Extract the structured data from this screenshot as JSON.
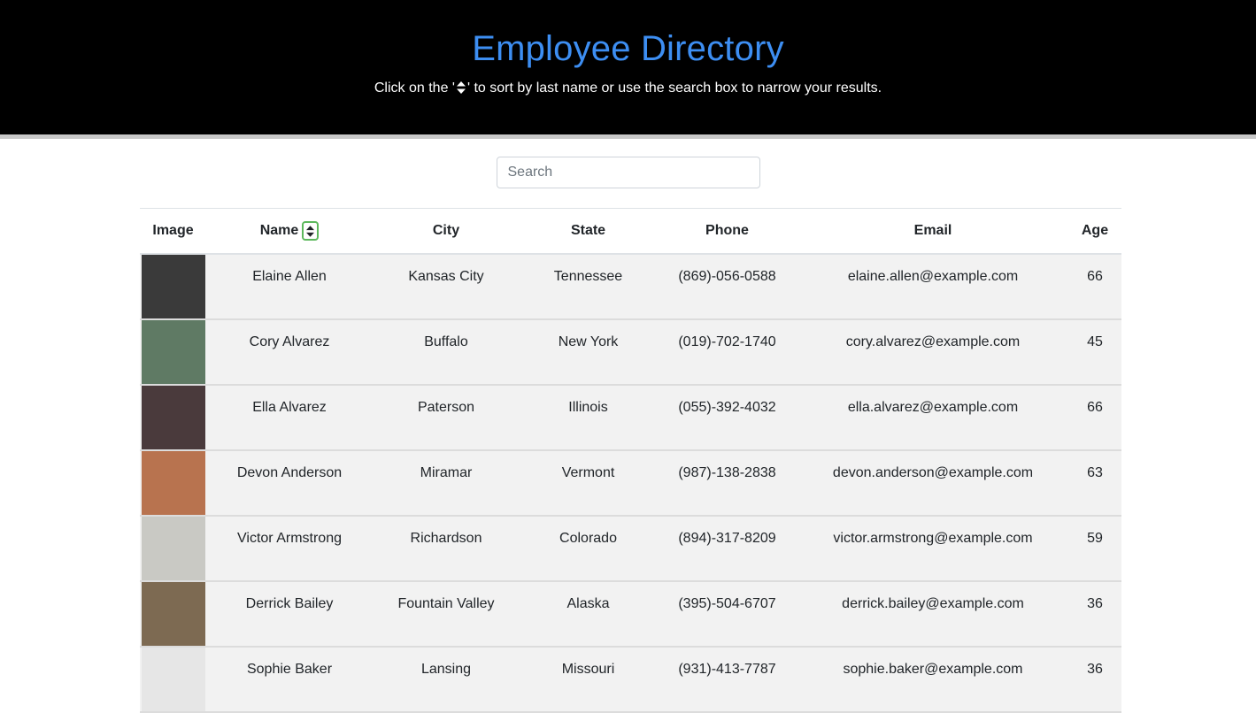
{
  "header": {
    "title": "Employee Directory",
    "subtitle_before": "Click on the '",
    "subtitle_after": "' to sort by last name or use the search box to narrow your results.",
    "sort_icon": "sort-icon",
    "title_color": "#3d8ef2"
  },
  "search": {
    "placeholder": "Search",
    "value": ""
  },
  "table": {
    "columns": [
      "Image",
      "Name",
      "City",
      "State",
      "Phone",
      "Email",
      "Age"
    ],
    "rows": [
      {
        "name": "Elaine Allen",
        "city": "Kansas City",
        "state": "Tennessee",
        "phone": "(869)-056-0588",
        "email": "elaine.allen@example.com",
        "age": "66",
        "avatar_color": "#3a3a3a"
      },
      {
        "name": "Cory Alvarez",
        "city": "Buffalo",
        "state": "New York",
        "phone": "(019)-702-1740",
        "email": "cory.alvarez@example.com",
        "age": "45",
        "avatar_color": "#5f7a64"
      },
      {
        "name": "Ella Alvarez",
        "city": "Paterson",
        "state": "Illinois",
        "phone": "(055)-392-4032",
        "email": "ella.alvarez@example.com",
        "age": "66",
        "avatar_color": "#4a3a3c"
      },
      {
        "name": "Devon Anderson",
        "city": "Miramar",
        "state": "Vermont",
        "phone": "(987)-138-2838",
        "email": "devon.anderson@example.com",
        "age": "63",
        "avatar_color": "#b8734f"
      },
      {
        "name": "Victor Armstrong",
        "city": "Richardson",
        "state": "Colorado",
        "phone": "(894)-317-8209",
        "email": "victor.armstrong@example.com",
        "age": "59",
        "avatar_color": "#c9c9c4"
      },
      {
        "name": "Derrick Bailey",
        "city": "Fountain Valley",
        "state": "Alaska",
        "phone": "(395)-504-6707",
        "email": "derrick.bailey@example.com",
        "age": "36",
        "avatar_color": "#7d6a52"
      },
      {
        "name": "Sophie Baker",
        "city": "Lansing",
        "state": "Missouri",
        "phone": "(931)-413-7787",
        "email": "sophie.baker@example.com",
        "age": "36",
        "avatar_color": "#e6e6e6"
      }
    ]
  }
}
